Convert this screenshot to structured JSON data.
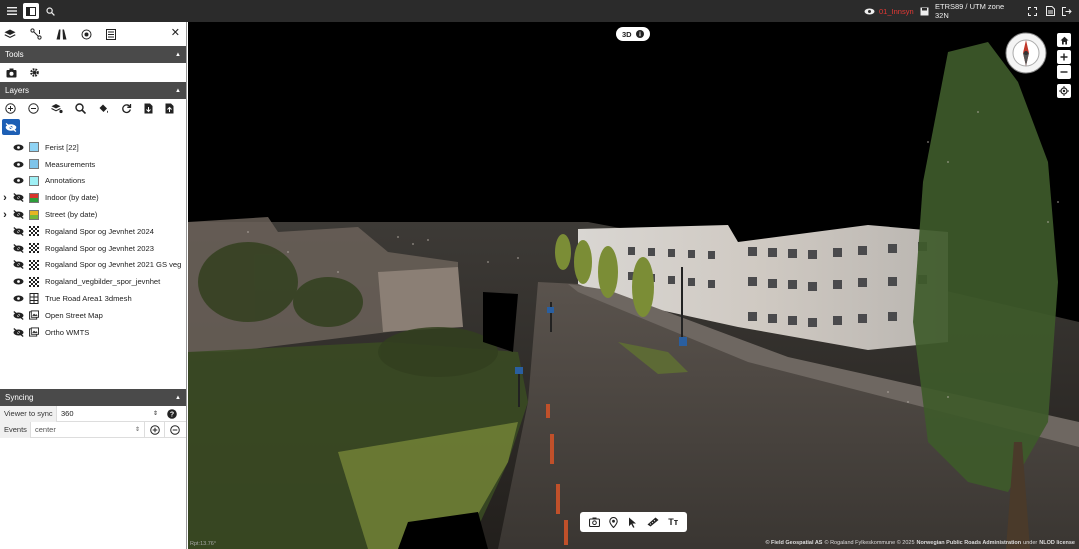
{
  "topbar": {
    "layer_name": "01_Innsyn",
    "crs": "ETRS89 / UTM zone 32N",
    "accent": "#e53935"
  },
  "sidebar": {
    "tools_title": "Tools",
    "layers_title": "Layers",
    "layers": [
      {
        "label": "Ferist [22]",
        "swatch": "#8fd3f4",
        "eye": "on",
        "kind": "swatch",
        "expand": false
      },
      {
        "label": "Measurements",
        "swatch": "#7fc4ea",
        "eye": "on",
        "kind": "swatch",
        "expand": false
      },
      {
        "label": "Annotations",
        "swatch": "#9ff0f5",
        "eye": "on",
        "kind": "swatch",
        "expand": false
      },
      {
        "label": "Indoor (by date)",
        "swatch": "#d9352b",
        "eye": "off",
        "kind": "swatch",
        "expand": true
      },
      {
        "label": "Street (by date)",
        "swatch": "#e6b422",
        "eye": "off",
        "kind": "swatch",
        "expand": true
      },
      {
        "label": "Rogaland Spor og Jevnhet 2024",
        "eye": "off",
        "kind": "pointcloud",
        "expand": false
      },
      {
        "label": "Rogaland Spor og Jevnhet 2023",
        "eye": "off",
        "kind": "pointcloud",
        "expand": false
      },
      {
        "label": "Rogaland Spor og Jevnhet 2021 GS veg",
        "eye": "off",
        "kind": "pointcloud",
        "expand": false
      },
      {
        "label": "Rogaland_vegbilder_spor_jevnhet",
        "eye": "on",
        "kind": "pointcloud",
        "expand": false
      },
      {
        "label": "True Road Area1 3dmesh",
        "eye": "on",
        "kind": "mesh",
        "expand": false
      },
      {
        "label": "Open Street Map",
        "eye": "off",
        "kind": "map",
        "expand": false
      },
      {
        "label": "Ortho WMTS",
        "eye": "off",
        "kind": "map",
        "expand": false
      }
    ],
    "syncing_title": "Syncing",
    "viewer_to_sync_label": "Viewer to sync",
    "viewer_to_sync_value": "360",
    "events_label": "Events",
    "events_value": "center"
  },
  "viewer": {
    "mode_label": "3D",
    "coords_text": "Rpt:13.76°",
    "attribution_1": "© Field Geospatial AS",
    "attribution_2": "© Rogaland Fylkeskommune © 2025",
    "attribution_3": "Norwegian Public Roads Administration",
    "attribution_4": "under",
    "attribution_5": "NLOD license"
  }
}
